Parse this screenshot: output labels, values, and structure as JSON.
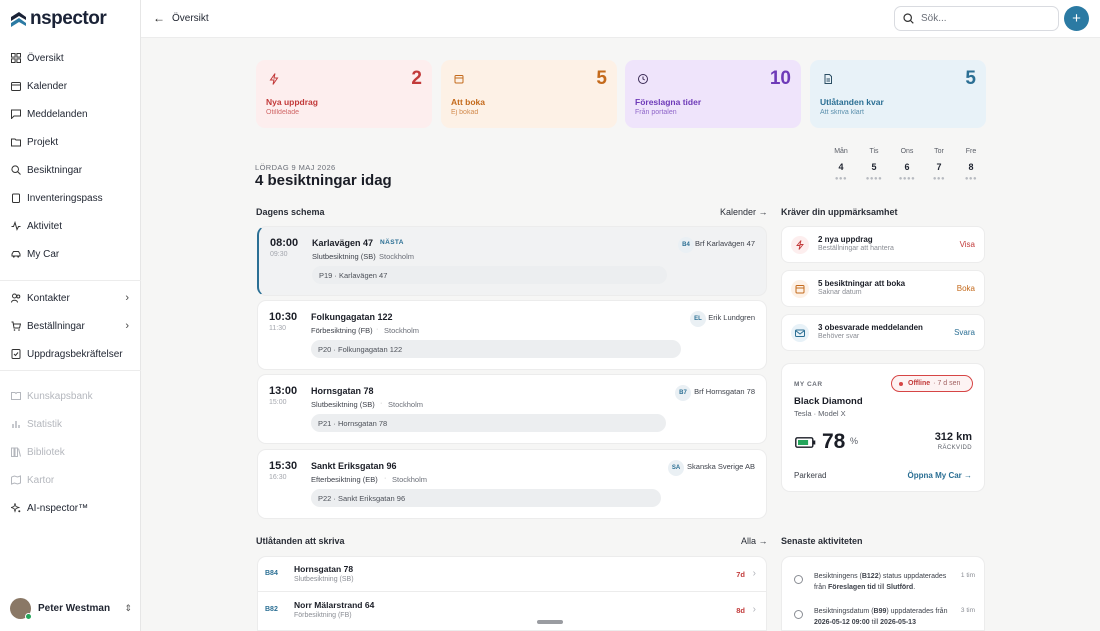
{
  "brand": {
    "logo_text": "nspector",
    "logo_color": "#2b7aa3"
  },
  "sidebar": {
    "items": [
      {
        "label": "Översikt",
        "icon": "grid-icon"
      },
      {
        "label": "Kalender",
        "icon": "calendar-icon"
      },
      {
        "label": "Meddelanden",
        "icon": "message-icon"
      },
      {
        "label": "Projekt",
        "icon": "folder-icon"
      },
      {
        "label": "Besiktningar",
        "icon": "search-document-icon"
      },
      {
        "label": "Inventeringspass",
        "icon": "clipboard-icon"
      },
      {
        "label": "Aktivitet",
        "icon": "activity-icon"
      },
      {
        "label": "My Car",
        "icon": "car-icon"
      }
    ],
    "groups": [
      {
        "label": "Kontakter",
        "icon": "users-icon"
      },
      {
        "label": "Beställningar",
        "icon": "cart-icon"
      },
      {
        "label": "Uppdragsbekräftelser",
        "icon": "check-document-icon"
      }
    ],
    "disabled": [
      {
        "label": "Kunskapsbank",
        "icon": "book-icon"
      },
      {
        "label": "Statistik",
        "icon": "chart-icon"
      },
      {
        "label": "Bibliotek",
        "icon": "library-icon"
      },
      {
        "label": "Kartor",
        "icon": "map-icon"
      }
    ],
    "ai": {
      "label": "AI-nspector™",
      "icon": "sparkle-icon"
    },
    "user": {
      "name": "Peter Westman"
    }
  },
  "topbar": {
    "breadcrumb": "Översikt",
    "search_placeholder": "Sök...",
    "add_label": "+"
  },
  "stats": [
    {
      "value": "2",
      "title": "Nya uppdrag",
      "sub": "Otilldelade",
      "bg": "#fdeeee",
      "fg": "#c23a3a",
      "icon": "bolt-icon"
    },
    {
      "value": "5",
      "title": "Att boka",
      "sub": "Ej bokad",
      "bg": "#fdf1e6",
      "fg": "#c46a1c",
      "icon": "calendar-icon"
    },
    {
      "value": "10",
      "title": "Föreslagna tider",
      "sub": "Från portalen",
      "bg": "#efe4fb",
      "fg": "#6e3ab8",
      "icon": "clock-icon"
    },
    {
      "value": "5",
      "title": "Utlåtanden kvar",
      "sub": "Att skriva klart",
      "bg": "#e8f2f8",
      "fg": "#2b6f94",
      "icon": "document-icon"
    }
  ],
  "today": {
    "date_label": "LÖRDAG 9 MAJ 2026",
    "headline": "4 besiktningar idag",
    "week": [
      {
        "day": "Mån",
        "num": "4"
      },
      {
        "day": "Tis",
        "num": "5"
      },
      {
        "day": "Ons",
        "num": "6"
      },
      {
        "day": "Tor",
        "num": "7"
      },
      {
        "day": "Fre",
        "num": "8"
      }
    ]
  },
  "schedule": {
    "title": "Dagens schema",
    "link": "Kalender →",
    "next_label": "NÄSTA",
    "items": [
      {
        "start": "08:00",
        "end": "09:30",
        "address": "Karlavägen 47",
        "type": "Slutbesiktning (SB)",
        "city": "Stockholm",
        "project": "P19 · Karlavägen 47",
        "badge": "B4",
        "client": "Brf Karlavägen 47"
      },
      {
        "start": "10:30",
        "end": "11:30",
        "address": "Folkungagatan 122",
        "type": "Förbesiktning (FB)",
        "city": "Stockholm",
        "project": "P20 · Folkungagatan 122",
        "badge": "EL",
        "client": "Erik Lundgren"
      },
      {
        "start": "13:00",
        "end": "15:00",
        "address": "Hornsgatan 78",
        "type": "Slutbesiktning (SB)",
        "city": "Stockholm",
        "project": "P21 · Hornsgatan 78",
        "badge": "B7",
        "client": "Brf Hornsgatan 78"
      },
      {
        "start": "15:30",
        "end": "16:30",
        "address": "Sankt Eriksgatan 96",
        "type": "Efterbesiktning (EB)",
        "city": "Stockholm",
        "project": "P22 · Sankt Eriksgatan 96",
        "badge": "SA",
        "client": "Skanska Sverige AB"
      }
    ]
  },
  "attention": {
    "title": "Kräver din uppmärksamhet",
    "items": [
      {
        "title": "2 nya uppdrag",
        "sub": "Beställningar att hantera",
        "action": "Visa",
        "color": "#c23a3a",
        "bg": "#fdeeee",
        "icon": "bolt-icon"
      },
      {
        "title": "5 besiktningar att boka",
        "sub": "Saknar datum",
        "action": "Boka",
        "color": "#c46a1c",
        "bg": "#fdf1e6",
        "icon": "calendar-icon"
      },
      {
        "title": "3 obesvarade meddelanden",
        "sub": "Behöver svar",
        "action": "Svara",
        "color": "#2b6f94",
        "bg": "#e8f2f8",
        "icon": "mail-icon"
      }
    ]
  },
  "car": {
    "label": "MY CAR",
    "status": "Offline",
    "status_ago": "· 7 d sen",
    "name": "Black Diamond",
    "model": "Tesla · Model X",
    "battery": "78",
    "battery_unit": "%",
    "battery_level": 0.78,
    "range": "312 km",
    "range_label": "RÄCKVIDD",
    "state": "Parkerad",
    "link": "Öppna My Car →"
  },
  "reports": {
    "title": "Utlåtanden att skriva",
    "link": "Alla →",
    "items": [
      {
        "code": "B84",
        "address": "Hornsgatan 78",
        "type": "Slutbesiktning (SB)",
        "age": "7d",
        "age_color": "#c23a3a"
      },
      {
        "code": "B82",
        "address": "Norr Mälarstrand 64",
        "type": "Förbesiktning (FB)",
        "age": "8d",
        "age_color": "#c23a3a"
      }
    ]
  },
  "activity": {
    "title": "Senaste aktiviteten",
    "items": [
      {
        "pre": "Besiktningens (",
        "bold1": "B122",
        "mid": ") status uppdaterades från ",
        "bold2": "Föreslagen tid",
        "mid2": " till ",
        "bold3": "Slutförd",
        "end": ".",
        "time": "1 tim"
      },
      {
        "pre": "Besiktningsdatum (",
        "bold1": "B99",
        "mid": ") uppdaterades från ",
        "bold2": "2026-05-12 09:00",
        "mid2": " till ",
        "bold3": "2026-05-13",
        "end": "",
        "time": "3 tim"
      }
    ]
  }
}
